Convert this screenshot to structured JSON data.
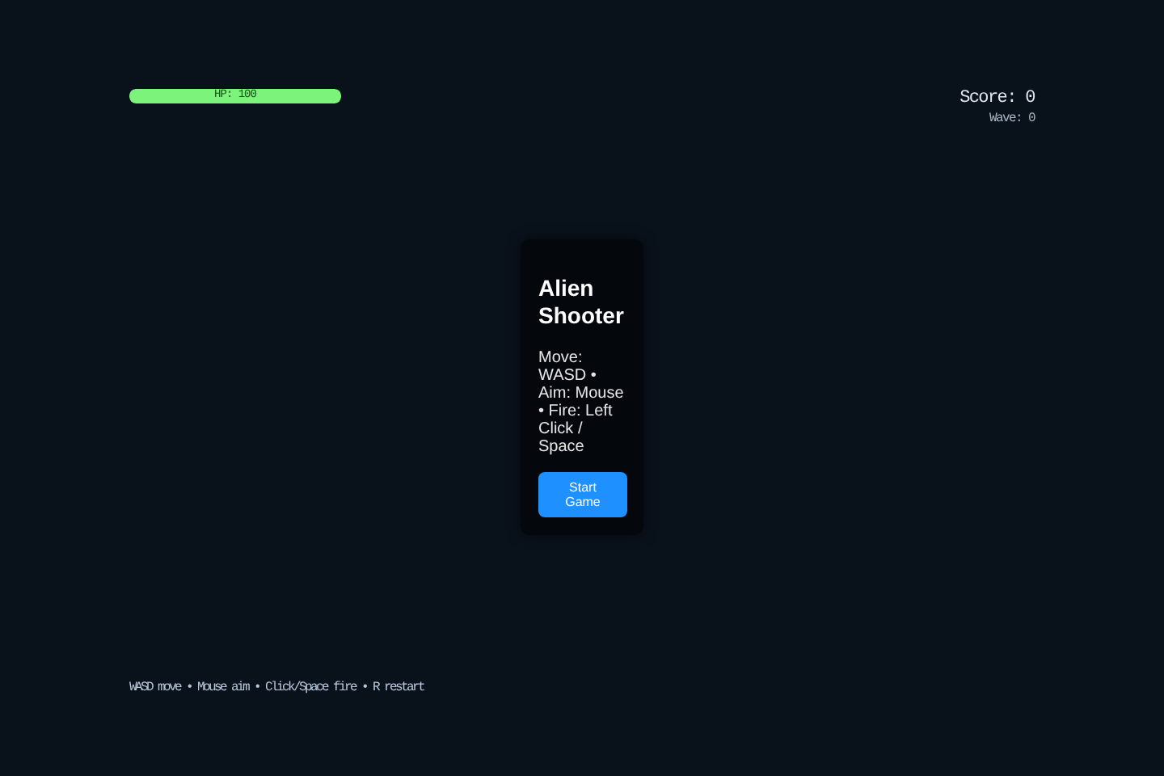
{
  "hud": {
    "hp": {
      "label": "HP: 100",
      "level": 1
    },
    "score": "Score: 0",
    "wave": "Wave: 0"
  },
  "menu": {
    "title": "Alien Shooter",
    "instructions": "Move: WASD • Aim: Mouse • Fire: Left Click / Space",
    "button": "Start Game"
  },
  "footer": "WASD move • Mouse aim • Click/Space fire • R restart"
}
